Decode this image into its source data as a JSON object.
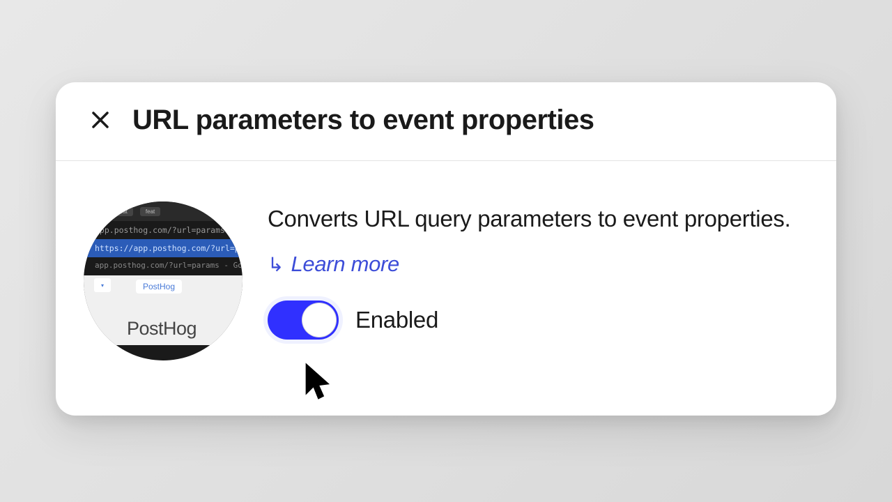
{
  "modal": {
    "title": "URL parameters to event properties",
    "description": "Converts URL query parameters to event properties.",
    "learn_more_label": "Learn more",
    "toggle": {
      "state": "on",
      "label": "Enabled"
    }
  },
  "app_icon": {
    "tab_label_1": "feat",
    "tab_label_2": "feat",
    "url_1": "app.posthog.com/?url=params",
    "url_2": "https://app.posthog.com/?url=params",
    "url_3": "app.posthog.com/?url=params - Go",
    "browser_tab": "PostHog",
    "logo_text": "PostHog"
  }
}
